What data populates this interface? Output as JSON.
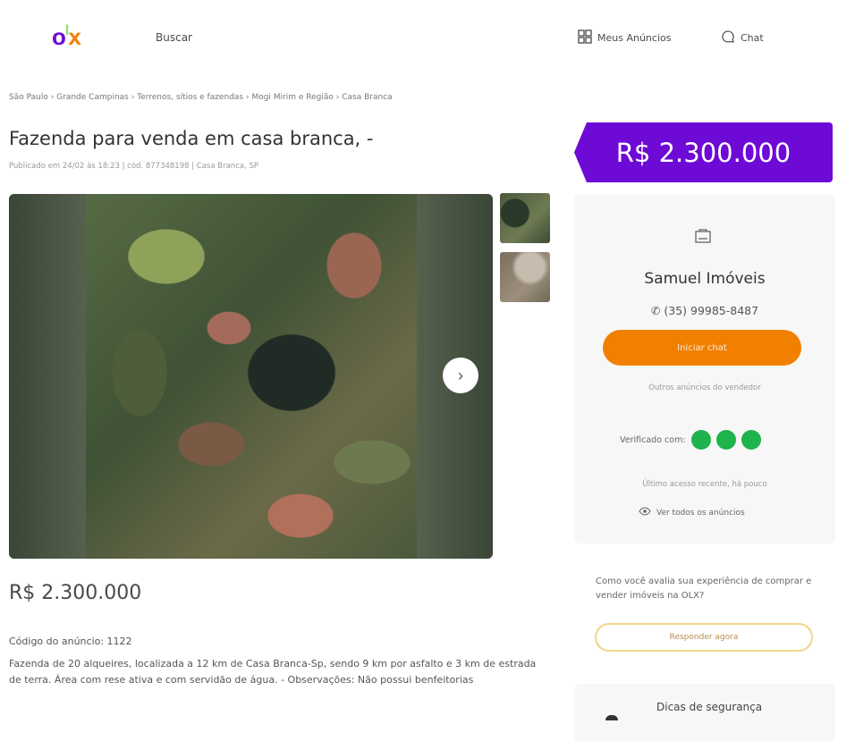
{
  "header": {
    "logo": {
      "o": "o",
      "l": "l",
      "x": "x"
    },
    "search_label": "Buscar",
    "my_ads_label": "Meus Anúncios",
    "chat_label": "Chat"
  },
  "breadcrumb": "São Paulo  ›  Grande Campinas  ›  Terrenos, sítios e fazendas  ›  Mogi Mirim e Região  ›  Casa Branca",
  "listing": {
    "title": "Fazenda para venda em casa branca, -",
    "published": "Publicado em 24/02 às 18:23  |  cód. 877348198  |  Casa Branca, SP",
    "price": "R$ 2.300.000",
    "code": "Código do anúncio: 1122",
    "description": "Fazenda de 20 alqueires, localizada a 12 km de Casa Branca-Sp, sendo 9 km por asfalto e 3 km de estrada de terra. Área com rese ativa e com servidão de água. - Observações: Não possui benfeitorias"
  },
  "seller_card": {
    "price_badge": "R$ 2.300.000",
    "seller_name": "Samuel Imóveis",
    "phone": "(35) 99985-8487",
    "chat_button": "Iniciar chat",
    "see_all_ads": "Outros anúncios do vendedor",
    "verified_label": "Verificado com:",
    "last_access": "Último acesso recente, há pouco",
    "see_ads_link": "Ver todos os anúncios"
  },
  "survey": {
    "text": "Como você avalia sua experiência de comprar e vender imóveis na OLX?",
    "button": "Responder agora"
  },
  "safety": {
    "title": "Dicas de segurança"
  },
  "colors": {
    "brand_purple": "#6e0ad6",
    "brand_orange": "#f28000",
    "brand_green": "#8ce563",
    "verified_green": "#1eb34c"
  }
}
